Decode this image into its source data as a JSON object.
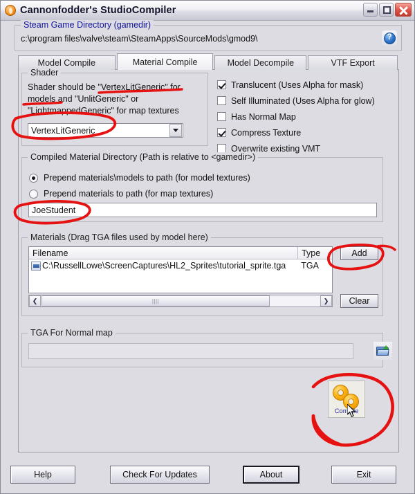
{
  "window": {
    "title": "Cannonfodder's StudioCompiler",
    "app_icon": "flame-icon",
    "minimize_label": "Minimize",
    "maximize_label": "Maximize",
    "close_label": "Close"
  },
  "gamedir": {
    "legend": "Steam Game Directory (gamedir)",
    "path": "c:\\program files\\valve\\steam\\SteamApps\\SourceMods\\gmod9\\",
    "help_glyph": "?"
  },
  "tabs": [
    {
      "label": "Model Compile",
      "active": false
    },
    {
      "label": "Material Compile",
      "active": true
    },
    {
      "label": "Model Decompile",
      "active": false
    },
    {
      "label": "VTF Export",
      "active": false
    }
  ],
  "shader": {
    "legend": "Shader",
    "description": "Shader should be \"VertexLitGeneric\" for models and \"UnlitGeneric\" or \"LightmappedGeneric\" for map textures",
    "selected": "VertexLitGeneric",
    "options": [
      "VertexLitGeneric",
      "UnlitGeneric",
      "LightmappedGeneric"
    ]
  },
  "checkboxes": [
    {
      "label": "Translucent (Uses Alpha for mask)",
      "checked": true
    },
    {
      "label": "Self Illuminated (Uses Alpha for glow)",
      "checked": false
    },
    {
      "label": "Has Normal Map",
      "checked": false
    },
    {
      "label": "Compress Texture",
      "checked": true
    },
    {
      "label": "Overwrite existing VMT",
      "checked": false
    }
  ],
  "material_directory": {
    "legend": "Compiled Material Directory (Path is relative to <gamedir>)",
    "radios": [
      {
        "label": "Prepend materials\\models to path (for model textures)",
        "selected": true
      },
      {
        "label": "Prepend materials to path (for map textures)",
        "selected": false
      }
    ],
    "input_value": "JoeStudent",
    "input_placeholder": ""
  },
  "materials": {
    "legend": "Materials (Drag TGA files used by model here)",
    "columns": [
      "Filename",
      "Type"
    ],
    "rows": [
      {
        "filename": "C:\\RussellLowe\\ScreenCaptures\\HL2_Sprites\\tutorial_sprite.tga",
        "type": "TGA",
        "icon": "tga-file-icon"
      }
    ],
    "add_label": "Add",
    "clear_label": "Clear",
    "scroll_left_glyph": "❮",
    "scroll_right_glyph": "❯",
    "grip_glyph": "||||"
  },
  "normal_map": {
    "legend": "TGA For Normal map",
    "input_value": "",
    "input_placeholder": "",
    "browse_icon": "open-folder-icon"
  },
  "compile": {
    "label": "Compile",
    "icon": "gears-icon"
  },
  "footer": {
    "help": "Help",
    "check_for_updates": "Check For Updates",
    "about": "About",
    "exit": "Exit"
  },
  "annotations": {
    "color": "#e61111",
    "marks": [
      "underline-vertexlitgeneric-in-text",
      "underline-models",
      "ellipse-shader-combo",
      "ellipse-joestudent-field",
      "ellipse-add-button",
      "ellipse-compile-button"
    ]
  },
  "colors": {
    "window_background": "#dcdce2",
    "field_background": "#ffffff",
    "annotation_red": "#e61111",
    "legend_blue": "#12149c",
    "compile_label_blue": "#2a2a9c"
  }
}
